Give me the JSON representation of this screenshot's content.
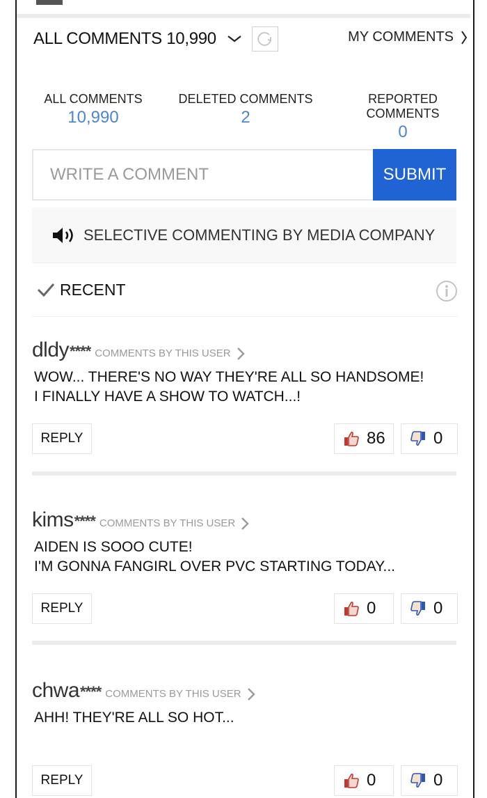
{
  "header": {
    "title": "ALL COMMENTS 10,990",
    "my_comments_label": "MY COMMENTS"
  },
  "stats": [
    {
      "label": "ALL COMMENTS",
      "value": "10,990"
    },
    {
      "label": "DELETED COMMENTS",
      "value": "2"
    },
    {
      "label": "REPORTED COMMENTS",
      "value": "0"
    }
  ],
  "form": {
    "placeholder": "WRITE A COMMENT",
    "submit_label": "SUBMIT"
  },
  "notice": {
    "text": "SELECTIVE COMMENTING BY MEDIA COMPANY"
  },
  "sort": {
    "label": "RECENT"
  },
  "colors": {
    "accent": "#1f63d4",
    "stat_value": "#4a86d0",
    "like": "#c0392b",
    "dislike": "#2e57b5"
  },
  "comments": [
    {
      "user": "dldy",
      "mask": "****",
      "user_link": "COMMENTS BY THIS USER",
      "lines": [
        "WOW... THERE'S NO WAY THEY'RE ALL SO HANDSOME!",
        "I FINALLY HAVE A SHOW TO WATCH...!"
      ],
      "reply_label": "REPLY",
      "likes": "86",
      "dislikes": "0"
    },
    {
      "user": "kims",
      "mask": "****",
      "user_link": "COMMENTS BY THIS USER",
      "lines": [
        "AIDEN IS SOOO CUTE!",
        "I'M GONNA FANGIRL OVER PVC STARTING TODAY..."
      ],
      "reply_label": "REPLY",
      "likes": "0",
      "dislikes": "0"
    },
    {
      "user": "chwa",
      "mask": "****",
      "user_link": "COMMENTS BY THIS USER",
      "lines": [
        "AHH! THEY'RE ALL SO HOT..."
      ],
      "reply_label": "REPLY",
      "likes": "0",
      "dislikes": "0"
    }
  ]
}
